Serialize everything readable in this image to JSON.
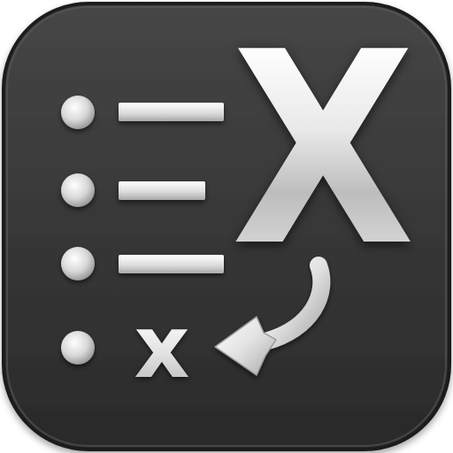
{
  "app_icon": {
    "glyphs": {
      "large_letter": "X",
      "small_letter": "x"
    },
    "list": {
      "bullet_count": 4,
      "line_count": 3
    },
    "colors": {
      "background": "#3a3a3a",
      "background_edge": "#1f1f1f",
      "foreground_light": "#f2f2f2",
      "foreground_mid": "#cfcfcf",
      "foreground_dark": "#9a9a9a"
    },
    "icons": [
      "bullet-list-icon",
      "curved-arrow-left-icon"
    ]
  }
}
